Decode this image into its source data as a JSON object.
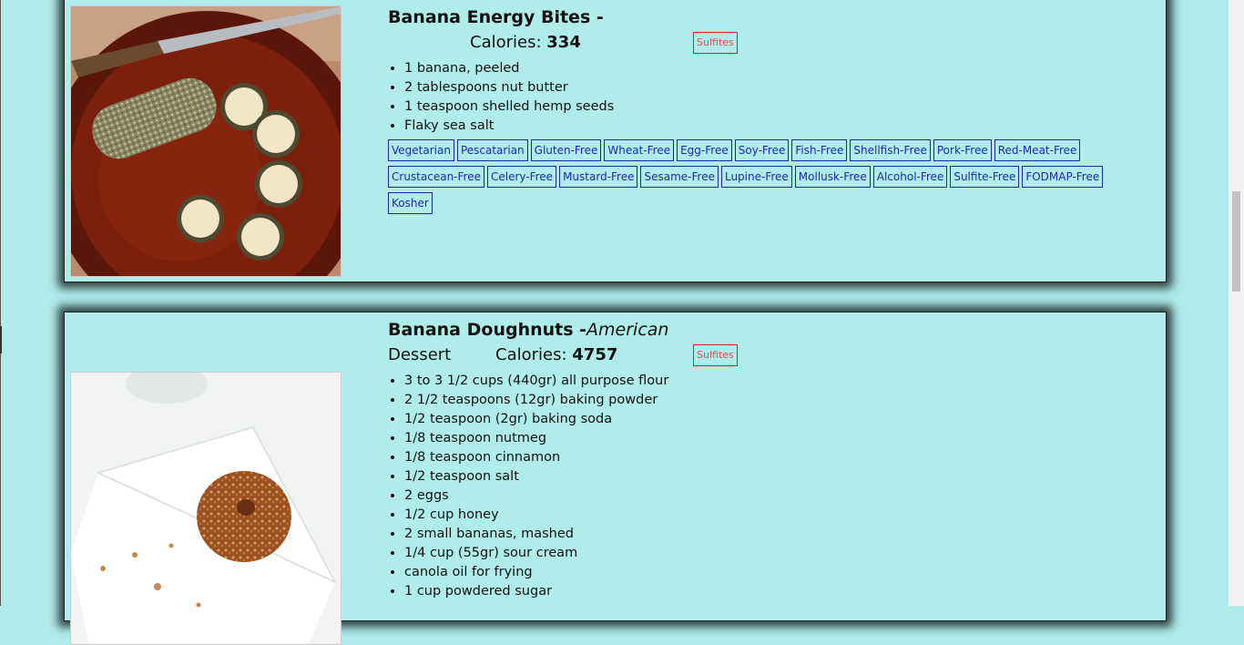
{
  "recipes": [
    {
      "title": "Banana Energy Bites -",
      "cuisine": "",
      "dish_type": "",
      "calories_label": "Calories:",
      "calories": "334",
      "caution": "Sulfites",
      "ingredients": [
        "1 banana, peeled",
        "2 tablespoons nut butter",
        "1 teaspoon shelled hemp seeds",
        "Flaky sea salt"
      ],
      "health_labels": [
        "Vegetarian",
        "Pescatarian",
        "Gluten-Free",
        "Wheat-Free",
        "Egg-Free",
        "Soy-Free",
        "Fish-Free",
        "Shellfish-Free",
        "Pork-Free",
        "Red-Meat-Free",
        "Crustacean-Free",
        "Celery-Free",
        "Mustard-Free",
        "Sesame-Free",
        "Lupine-Free",
        "Mollusk-Free",
        "Alcohol-Free",
        "Sulfite-Free",
        "FODMAP-Free",
        "Kosher"
      ]
    },
    {
      "title": "Banana Doughnuts -",
      "cuisine": "American",
      "dish_type": "Dessert",
      "calories_label": "Calories:",
      "calories": "4757",
      "caution": "Sulfites",
      "ingredients": [
        "3 to 3 1/2 cups (440gr) all purpose flour",
        "2 1/2 teaspoons (12gr) baking powder",
        "1/2 teaspoon (2gr) baking soda",
        "1/8 teaspoon nutmeg",
        "1/8 teaspoon cinnamon",
        "1/2 teaspoon salt",
        "2 eggs",
        "1/2 cup honey",
        "2 small bananas, mashed",
        "1/4 cup (55gr) sour cream",
        "canola oil for frying",
        "1 cup powdered sugar"
      ],
      "health_labels": []
    }
  ]
}
